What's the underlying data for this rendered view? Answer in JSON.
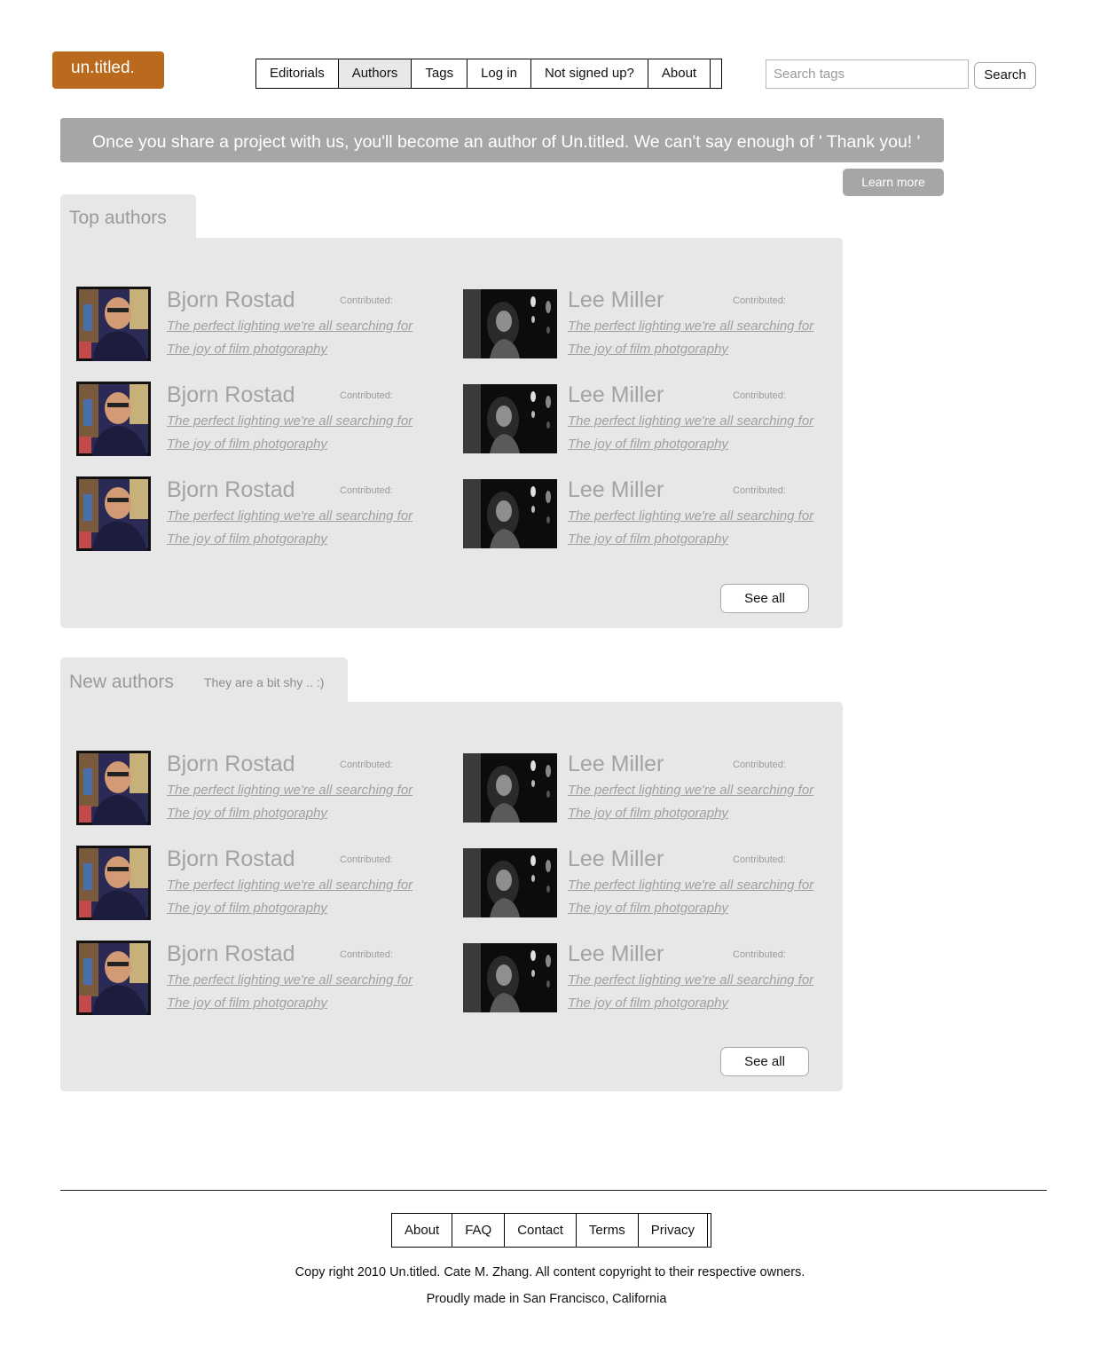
{
  "header": {
    "logo": "un.titled.",
    "nav": [
      "Editorials",
      "Authors",
      "Tags",
      "Log in",
      "Not signed up?",
      "About"
    ],
    "active_nav": "Authors",
    "search": {
      "placeholder": "Search tags",
      "button": "Search"
    }
  },
  "banner": {
    "text": "Once you share a project with us, you'll become an author of Un.titled. We can't say enough of  ' Thank you! '",
    "learn_more": "Learn more"
  },
  "top_authors": {
    "title": "Top authors",
    "cards": [
      {
        "name": "Bjorn Rostad",
        "contributed_label": "Contributed:",
        "works": [
          "The perfect lighting we're all searching for",
          "The joy of film photgoraphy"
        ]
      },
      {
        "name": "Lee Miller",
        "contributed_label": "Contributed:",
        "works": [
          "The perfect lighting we're all searching for",
          "The joy of film photgoraphy"
        ]
      },
      {
        "name": "Bjorn Rostad",
        "contributed_label": "Contributed:",
        "works": [
          "The perfect lighting we're all searching for",
          "The joy of film photgoraphy"
        ]
      },
      {
        "name": "Lee Miller",
        "contributed_label": "Contributed:",
        "works": [
          "The perfect lighting we're all searching for",
          "The joy of film photgoraphy"
        ]
      },
      {
        "name": "Bjorn Rostad",
        "contributed_label": "Contributed:",
        "works": [
          "The perfect lighting we're all searching for",
          "The joy of film photgoraphy"
        ]
      },
      {
        "name": "Lee Miller",
        "contributed_label": "Contributed:",
        "works": [
          "The perfect lighting we're all searching for",
          "The joy of film photgoraphy"
        ]
      }
    ],
    "see_all": "See all"
  },
  "new_authors": {
    "title": "New authors",
    "subtitle": "They are a bit shy .. :)",
    "cards": [
      {
        "name": "Bjorn Rostad",
        "contributed_label": "Contributed:",
        "works": [
          "The perfect lighting we're all searching for",
          "The joy of film photgoraphy"
        ]
      },
      {
        "name": "Lee Miller",
        "contributed_label": "Contributed:",
        "works": [
          "The perfect lighting we're all searching for",
          "The joy of film photgoraphy"
        ]
      },
      {
        "name": "Bjorn Rostad",
        "contributed_label": "Contributed:",
        "works": [
          "The perfect lighting we're all searching for",
          "The joy of film photgoraphy"
        ]
      },
      {
        "name": "Lee Miller",
        "contributed_label": "Contributed:",
        "works": [
          "The perfect lighting we're all searching for",
          "The joy of film photgoraphy"
        ]
      },
      {
        "name": "Bjorn Rostad",
        "contributed_label": "Contributed:",
        "works": [
          "The perfect lighting we're all searching for",
          "The joy of film photgoraphy"
        ]
      },
      {
        "name": "Lee Miller",
        "contributed_label": "Contributed:",
        "works": [
          "The perfect lighting we're all searching for",
          "The joy of film photgoraphy"
        ]
      }
    ],
    "see_all": "See all"
  },
  "footer": {
    "nav": [
      "About",
      "FAQ",
      "Contact",
      "Terms",
      "Privacy"
    ],
    "copyright": "Copy right 2010 Un.titled. Cate M. Zhang. All content copyright to their respective owners.",
    "made_in": "Proudly made in San Francisco, California"
  },
  "colors": {
    "logo_bg": "#b96a1c",
    "banner_bg": "#a6a6a6",
    "panel_bg": "#e7e7e7",
    "muted_text": "#a3a3a3"
  }
}
